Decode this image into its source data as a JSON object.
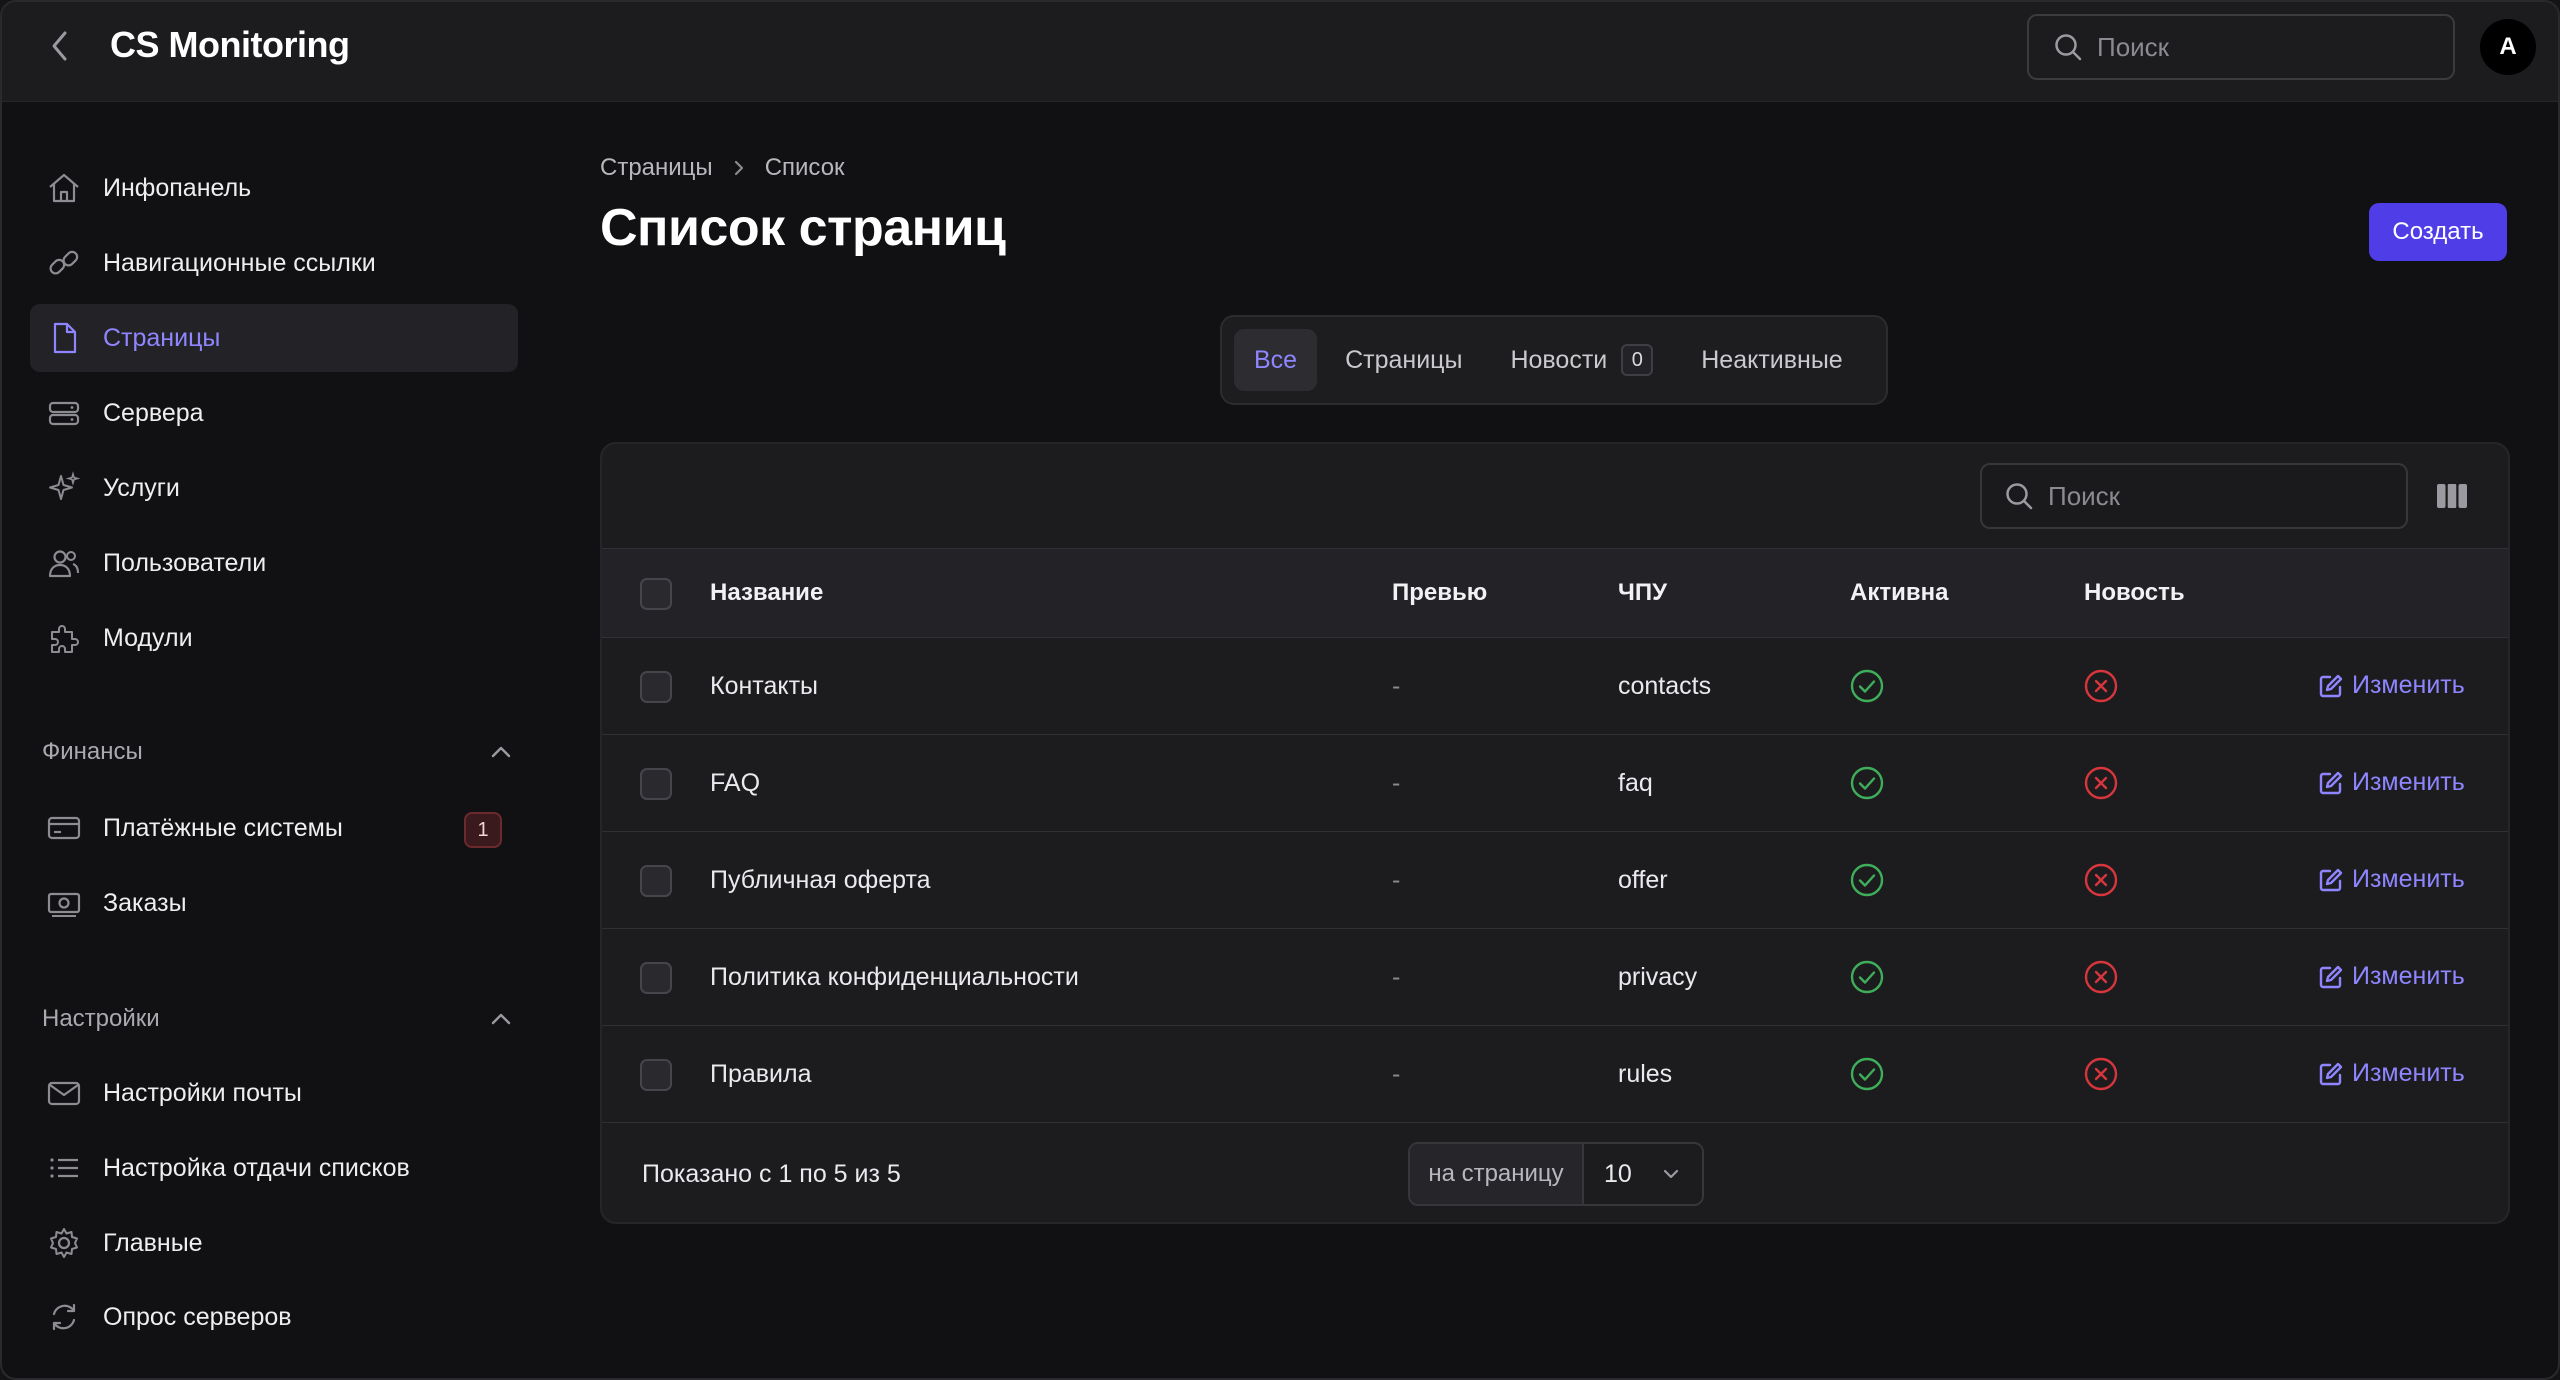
{
  "header": {
    "title": "CS Monitoring",
    "search_placeholder": "Поиск",
    "avatar_letter": "A"
  },
  "sidebar": {
    "items": [
      {
        "label": "Инфопанель",
        "icon": "home-icon"
      },
      {
        "label": "Навигационные ссылки",
        "icon": "link-icon"
      },
      {
        "label": "Страницы",
        "icon": "document-icon",
        "active": true
      },
      {
        "label": "Сервера",
        "icon": "server-icon"
      },
      {
        "label": "Услуги",
        "icon": "sparkles-icon"
      },
      {
        "label": "Пользователи",
        "icon": "users-icon"
      },
      {
        "label": "Модули",
        "icon": "puzzle-icon"
      }
    ],
    "groups": [
      {
        "label": "Финансы",
        "items": [
          {
            "label": "Платёжные системы",
            "icon": "credit-card-icon",
            "badge": "1"
          },
          {
            "label": "Заказы",
            "icon": "cash-icon"
          }
        ]
      },
      {
        "label": "Настройки",
        "items": [
          {
            "label": "Настройки почты",
            "icon": "mail-icon"
          },
          {
            "label": "Настройка отдачи списков",
            "icon": "list-icon"
          },
          {
            "label": "Главные",
            "icon": "gear-icon"
          },
          {
            "label": "Опрос серверов",
            "icon": "refresh-icon"
          }
        ]
      }
    ]
  },
  "breadcrumb": [
    "Страницы",
    "Список"
  ],
  "page_title": "Список страниц",
  "create_label": "Создать",
  "tabs": [
    {
      "label": "Все",
      "active": true
    },
    {
      "label": "Страницы"
    },
    {
      "label": "Новости",
      "count": "0"
    },
    {
      "label": "Неактивные"
    }
  ],
  "table": {
    "search_placeholder": "Поиск",
    "columns": [
      "Название",
      "Превью",
      "ЧПУ",
      "Активна",
      "Новость"
    ],
    "rows": [
      {
        "name": "Контакты",
        "preview": "-",
        "slug": "contacts",
        "active": true,
        "news": false,
        "edit": "Изменить"
      },
      {
        "name": "FAQ",
        "preview": "-",
        "slug": "faq",
        "active": true,
        "news": false,
        "edit": "Изменить"
      },
      {
        "name": "Публичная оферта",
        "preview": "-",
        "slug": "offer",
        "active": true,
        "news": false,
        "edit": "Изменить"
      },
      {
        "name": "Политика конфиденциальности",
        "preview": "-",
        "slug": "privacy",
        "active": true,
        "news": false,
        "edit": "Изменить"
      },
      {
        "name": "Правила",
        "preview": "-",
        "slug": "rules",
        "active": true,
        "news": false,
        "edit": "Изменить"
      }
    ],
    "footer": {
      "shown_text": "Показано с 1 по 5 из 5",
      "per_page_label": "на страницу",
      "per_page_value": "10"
    }
  },
  "colors": {
    "accent": "#4f3ee8",
    "accent_text": "#8f86ff",
    "success": "#3fae5a",
    "danger": "#d6363c"
  }
}
